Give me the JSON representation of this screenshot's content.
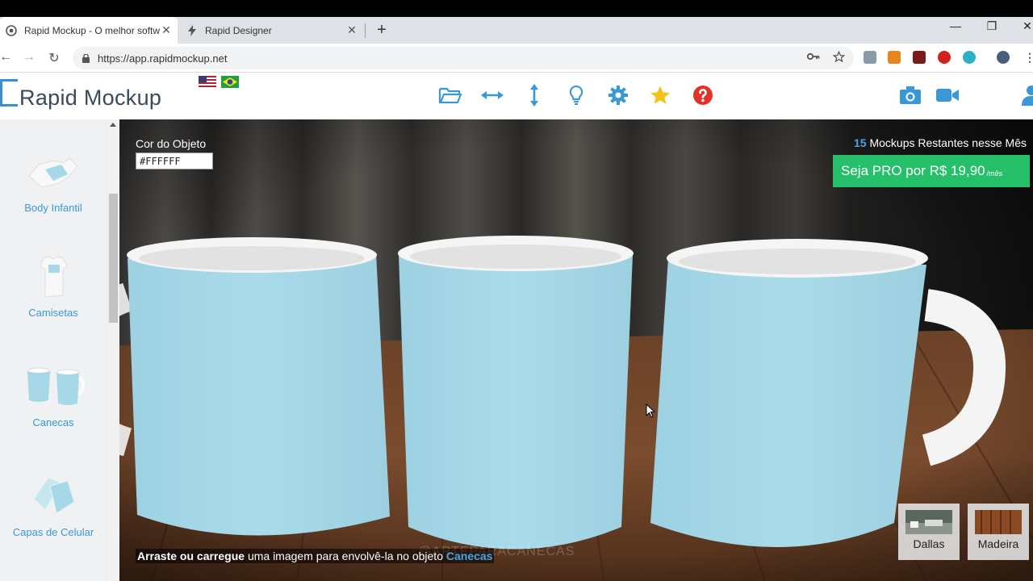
{
  "browser": {
    "tabs": [
      {
        "title": "Rapid Mockup - O melhor softw",
        "active": true,
        "icon": "globe-icon"
      },
      {
        "title": "Rapid Designer",
        "active": false,
        "icon": "bolt-icon"
      }
    ],
    "close_glyph": "✕",
    "new_tab_glyph": "+",
    "window_controls": {
      "minimize": "—",
      "restore": "❐",
      "close": "✕"
    },
    "nav": {
      "back": "←",
      "forward": "→",
      "reload": "↻"
    },
    "url": "https://app.rapidmockup.net"
  },
  "app": {
    "logo_letter": "R",
    "logo_rest": "apid Mockup",
    "toolbar_icons": [
      "folder-open-icon",
      "resize-horizontal-icon",
      "resize-vertical-icon",
      "lightbulb-icon",
      "gear-icon",
      "star-icon",
      "help-icon",
      "camera-icon",
      "video-camera-icon",
      "user-icon"
    ]
  },
  "sidebar": {
    "items": [
      {
        "label": "Body Infantil"
      },
      {
        "label": "Camisetas"
      },
      {
        "label": "Canecas"
      },
      {
        "label": "Capas de Celular"
      }
    ]
  },
  "scene": {
    "object_color_label": "Cor do Objeto",
    "object_color_value": "#FFFFFF",
    "remaining_count": "15",
    "remaining_text": "Mockups Restantes nesse Mês",
    "pro_label": "Seja PRO por R$ 19,90",
    "pro_sub": "/mês",
    "instr_bold": "Arraste ou carregue",
    "instr_rest": " uma imagem para envolvê-la no objeto ",
    "instr_object": "Canecas",
    "watermark": "@ARTEPARACANECAS",
    "environments": [
      {
        "label": "Dallas"
      },
      {
        "label": "Madeira"
      }
    ],
    "mug_color": "#a6d8e8"
  }
}
